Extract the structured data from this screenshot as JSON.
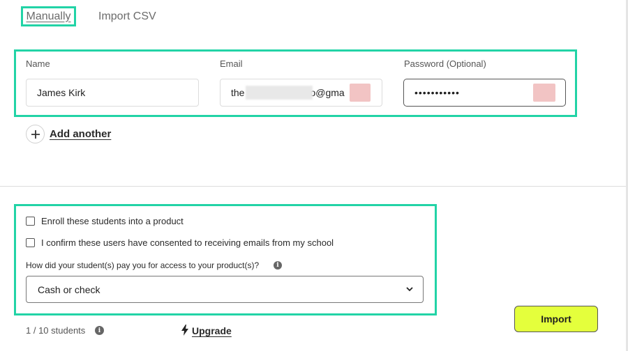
{
  "tabs": [
    {
      "label": "Manually",
      "active": true
    },
    {
      "label": "Import CSV",
      "active": false
    }
  ],
  "user_row": {
    "name": {
      "label": "Name",
      "value": "James Kirk"
    },
    "email": {
      "label": "Email",
      "value_start": "the",
      "value_end": "o@gma"
    },
    "password": {
      "label": "Password (Optional)",
      "value": "•••••••••••"
    }
  },
  "add_another": {
    "icon": "plus-icon",
    "label": "Add another"
  },
  "options": {
    "enroll_label": "Enroll these students into a product",
    "consent_label": "I confirm these users have consented to receiving emails from my school",
    "question": "How did your student(s) pay you for access to your product(s)?",
    "payment_selected": "Cash or check"
  },
  "footer": {
    "student_count": "1 / 10 students",
    "upgrade_label": "Upgrade",
    "import_label": "Import"
  },
  "colors": {
    "highlight": "#22d3a6",
    "import_button": "#e4ff3c"
  }
}
